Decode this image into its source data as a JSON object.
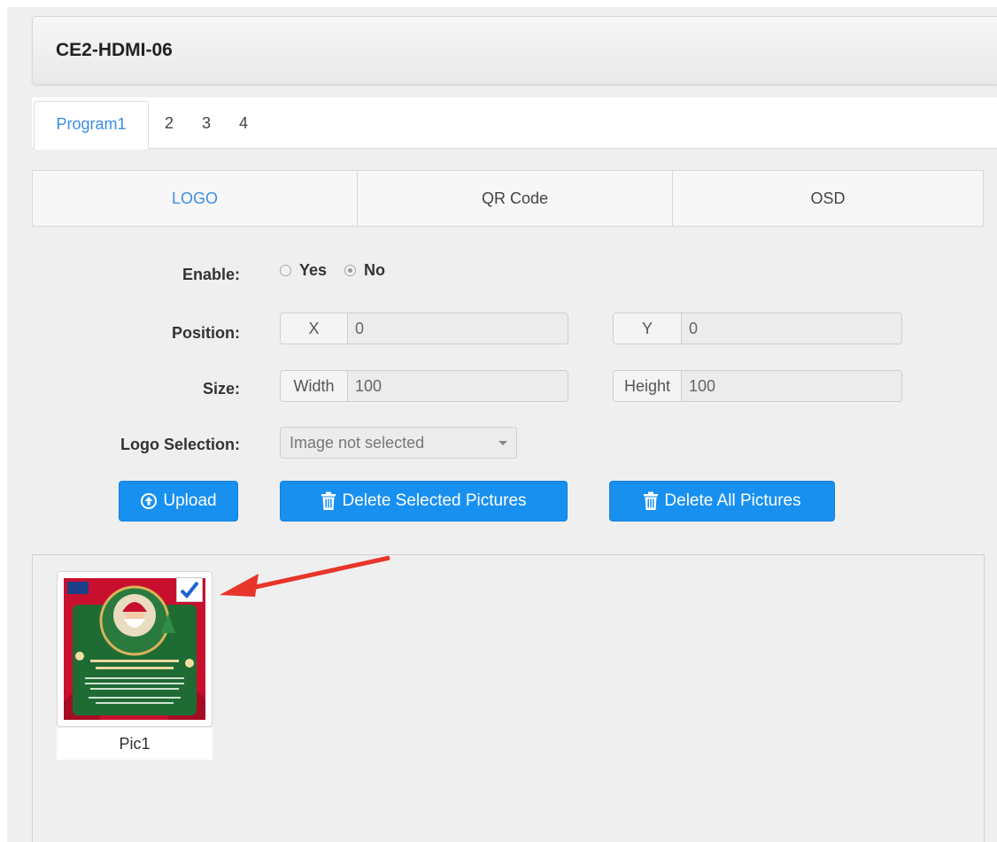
{
  "header": {
    "title": "CE2-HDMI-06"
  },
  "program_tabs": [
    "Program1",
    "2",
    "3",
    "4"
  ],
  "subtabs": {
    "logo": "LOGO",
    "qr": "QR Code",
    "osd": "OSD"
  },
  "form": {
    "enable_label": "Enable:",
    "yes_label": "Yes",
    "no_label": "No",
    "enable_value": "No",
    "position_label": "Position:",
    "x_addon": "X",
    "x_value": "0",
    "y_addon": "Y",
    "y_value": "0",
    "size_label": "Size:",
    "width_addon": "Width",
    "width_value": "100",
    "height_addon": "Height",
    "height_value": "100",
    "logo_selection_label": "Logo Selection:",
    "logo_selection_value": "Image not selected"
  },
  "buttons": {
    "upload": "Upload",
    "delete_selected": "Delete Selected Pictures",
    "delete_all": "Delete All Pictures"
  },
  "gallery": {
    "items": [
      {
        "label": "Pic1",
        "selected": true
      }
    ]
  },
  "colors": {
    "accent": "#1890f0",
    "link": "#3b8ee8",
    "annotation_arrow": "#e8352a"
  }
}
